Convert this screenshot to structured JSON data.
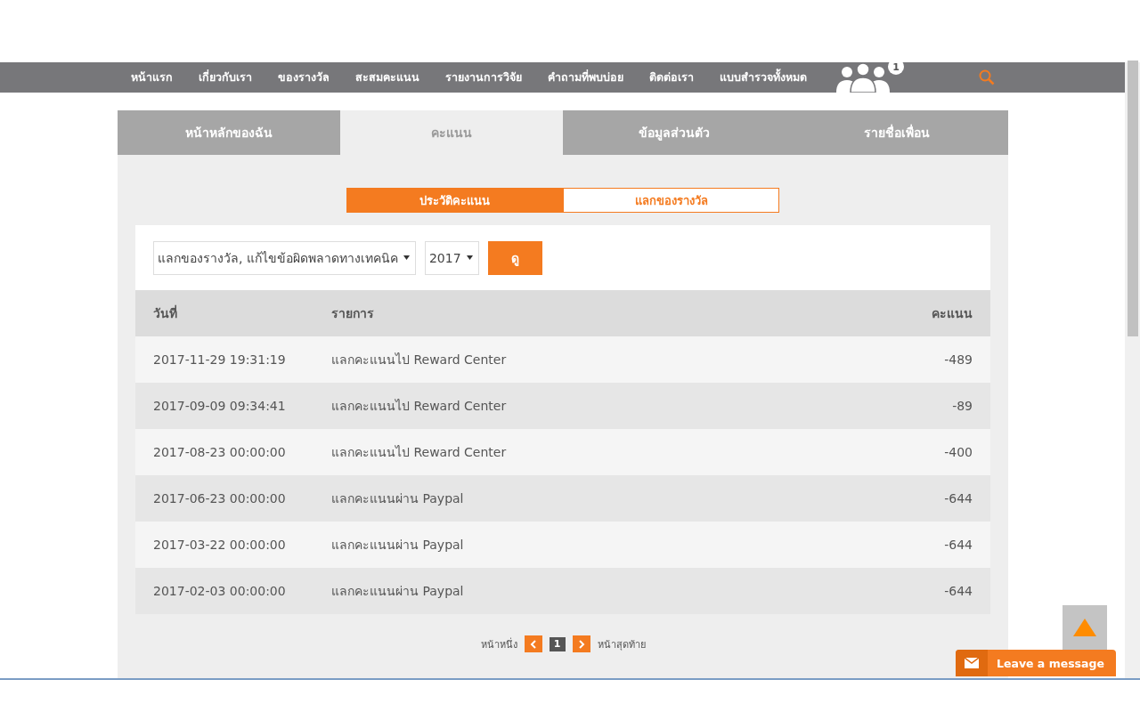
{
  "nav": {
    "items": [
      "หน้าแรก",
      "เกี่ยวกับเรา",
      "ของรางวัล",
      "สะสมคะแนน",
      "รายงานการวิจัย",
      "คำถามที่พบบ่อย",
      "ติดต่อเรา",
      "แบบสำรวจทั้งหมด"
    ],
    "friends_badge": "1"
  },
  "tabs": [
    {
      "label": "หน้าหลักของฉัน",
      "selected": false
    },
    {
      "label": "คะแนน",
      "selected": true
    },
    {
      "label": "ข้อมูลส่วนตัว",
      "selected": false
    },
    {
      "label": "รายชื่อเพื่อน",
      "selected": false
    }
  ],
  "subtabs": [
    {
      "label": "ประวัติคะแนน",
      "selected": true
    },
    {
      "label": "แลกของรางวัล",
      "selected": false
    }
  ],
  "filter": {
    "type_value": "แลกของรางวัล, แก้ไขข้อผิดพลาดทางเทคนิค",
    "year_value": "2017",
    "button": "ดู"
  },
  "table": {
    "columns": [
      "วันที่",
      "รายการ",
      "คะแนน"
    ],
    "rows": [
      [
        "2017-11-29 19:31:19",
        "แลกคะแนนไป Reward Center",
        "-489"
      ],
      [
        "2017-09-09 09:34:41",
        "แลกคะแนนไป Reward Center",
        "-89"
      ],
      [
        "2017-08-23 00:00:00",
        "แลกคะแนนไป Reward Center",
        "-400"
      ],
      [
        "2017-06-23 00:00:00",
        "แลกคะแนนผ่าน Paypal",
        "-644"
      ],
      [
        "2017-03-22 00:00:00",
        "แลกคะแนนผ่าน Paypal",
        "-644"
      ],
      [
        "2017-02-03 00:00:00",
        "แลกคะแนนผ่าน Paypal",
        "-644"
      ]
    ]
  },
  "pagination": {
    "first": "หน้าหนึ่ง",
    "last": "หน้าสุดท้าย",
    "pages": [
      {
        "label": "1",
        "selected": true
      }
    ]
  },
  "chat": {
    "label": "Leave a message"
  }
}
